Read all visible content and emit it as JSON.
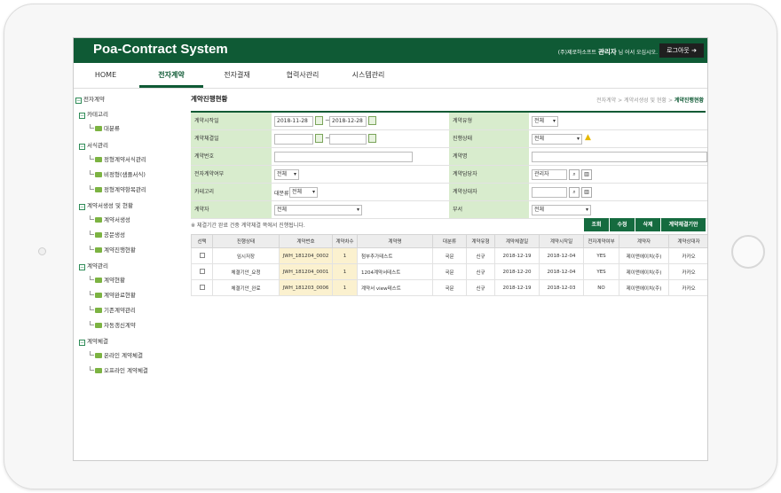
{
  "app": {
    "brand": "Poa-Contract System",
    "company": "(주)제로하소프트",
    "user": "관리자",
    "greeting": "님 어서 오십시오.",
    "logout_label": "로그아웃",
    "logout_icon": "arrow-right-icon",
    "accent": "#0f5a35"
  },
  "nav": {
    "items": [
      "HOME",
      "전자계약",
      "전자결재",
      "협력사관리",
      "시스템관리"
    ],
    "active": "전자계약"
  },
  "sidebar": {
    "root": "전자계약",
    "groups": [
      {
        "label": "카테고리",
        "items": [
          "대분류"
        ]
      },
      {
        "label": "서식관리",
        "items": [
          "정형계약서식관리",
          "비정형(샘플서식)",
          "정형계약항목관리"
        ]
      },
      {
        "label": "계약서생성 및 현황",
        "items": [
          "계약서생성",
          "공문생성",
          "계약진행현황"
        ]
      },
      {
        "label": "계약관리",
        "items": [
          "계약현황",
          "계약완료현황",
          "기존계약관리",
          "자동갱신계약"
        ]
      },
      {
        "label": "계약체결",
        "items": [
          "온라인 계약체결",
          "오프라인 계약체결"
        ]
      }
    ]
  },
  "page": {
    "title": "계약진행현황",
    "breadcrumb": [
      "전자계약",
      "계약서생성 및 현황"
    ],
    "breadcrumb_current": "계약진행현황"
  },
  "search": {
    "l_contract_start": "계약시작일",
    "start_from": "2018-11-28",
    "start_to": "2018-12-28",
    "l_contract_end": "계약체결일",
    "l_contract_no": "계약번호",
    "l_conclusion": "전자계약여부",
    "conclusion_value": "전체",
    "l_category": "카테고리",
    "category_major": "대분류",
    "category_value": "전체",
    "l_contractor": "계약자",
    "contractor_value": "전체",
    "l_contract_type": "계약유형",
    "contract_type_value": "전체",
    "l_progress": "진행상태",
    "progress_value": "전체",
    "l_contract_name": "계약명",
    "l_manager": "계약담당자",
    "manager_value": "관리자",
    "l_counterpart": "계약상대자",
    "l_dept": "부서",
    "dept_value": "전체"
  },
  "note": "※ 체결기간 완료 건중 계약체결 쪽에서 진행됩니다.",
  "buttons": [
    "조회",
    "수정",
    "삭제",
    "계약체결기안"
  ],
  "table": {
    "headers": [
      "선택",
      "진행상태",
      "계약번호",
      "계약차수",
      "계약명",
      "대분류",
      "계약유형",
      "계약체결일",
      "계약시작일",
      "전자계약여부",
      "계약자",
      "계약상대자"
    ],
    "rows": [
      [
        "",
        "임시저장",
        "JWH_181204_0002",
        "1",
        "첨부추가테스트",
        "국문",
        "신규",
        "2018-12-19",
        "2018-12-04",
        "YES",
        "제이앤에이치(주)",
        "카카오"
      ],
      [
        "",
        "체결기안_요청",
        "JWH_181204_0001",
        "1",
        "1204계약서테스트",
        "국문",
        "신규",
        "2018-12-20",
        "2018-12-04",
        "YES",
        "제이앤에이치(주)",
        "카카오"
      ],
      [
        "",
        "체결기안_완료",
        "JWH_181203_0006",
        "1",
        "계약서 view테스트",
        "국문",
        "신규",
        "2018-12-19",
        "2018-12-03",
        "NO",
        "제이앤에이치(주)",
        "카카오"
      ]
    ]
  }
}
